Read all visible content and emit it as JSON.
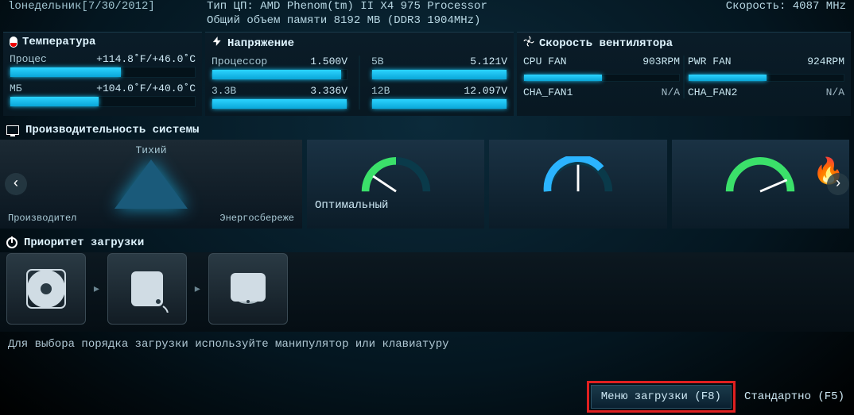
{
  "header": {
    "date": "lонедельник[7/30/2012]",
    "cpu_type": "Тип ЦП: AMD Phenom(tm) II X4 975 Processor",
    "memory": "Общий объем памяти 8192 MB (DDR3 1904MHz)",
    "speed": "Скорость: 4087 MHz"
  },
  "temperature": {
    "title": "Температура",
    "items": [
      {
        "label": "Процес",
        "value": "+114.8˚F/+46.0˚C",
        "bar": 60
      },
      {
        "label": "МБ",
        "value": "+104.0˚F/+40.0˚C",
        "bar": 48
      }
    ]
  },
  "voltage": {
    "title": "Напряжение",
    "left": [
      {
        "label": "Процессор",
        "value": "1.500V",
        "bar": 96
      },
      {
        "label": "3.3В",
        "value": "3.336V",
        "bar": 100
      }
    ],
    "right": [
      {
        "label": "5В",
        "value": "5.121V",
        "bar": 100
      },
      {
        "label": "12В",
        "value": "12.097V",
        "bar": 100
      }
    ]
  },
  "fan": {
    "title": "Скорость вентилятора",
    "left": [
      {
        "label": "CPU FAN",
        "value": "903RPM"
      },
      {
        "label": "CHA_FAN1",
        "value": "N/A"
      }
    ],
    "right": [
      {
        "label": "PWR FAN",
        "value": "924RPM"
      },
      {
        "label": "CHA_FAN2",
        "value": "N/A"
      }
    ]
  },
  "performance": {
    "title": "Производительность системы",
    "triangle": {
      "top": "Тихий",
      "bl": "Производител",
      "br": "Энергосбереже"
    },
    "optimal": "Оптимальный"
  },
  "boot": {
    "title": "Приоритет загрузки",
    "hint": "Для выбора порядка загрузки используйте манипулятор или клавиатуру"
  },
  "buttons": {
    "menu": "Меню загрузки (F8)",
    "standard": "Стандартно (F5)"
  }
}
